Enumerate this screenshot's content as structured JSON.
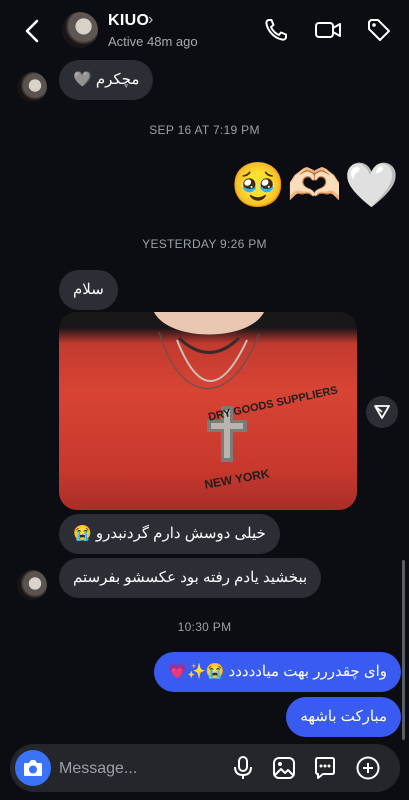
{
  "header": {
    "name": "KIUO",
    "status": "Active 48m ago"
  },
  "messages": {
    "m1": "مچکرم 🩶",
    "ts1": "SEP 16 AT 7:19 PM",
    "emoji_row": "🥹🫶🏻🤍",
    "ts2": "YESTERDAY 9:26 PM",
    "m2": "سلام",
    "m3": "خیلی دوسش دارم گردنبدرو 😭",
    "m4": "ببخشید یادم رفته بود عکسشو بفرستم",
    "ts3": "10:30 PM",
    "m5": "وای چقدررر بهت میاددددد 😭✨💗",
    "m6": "مبارکت باشهه"
  },
  "photo": {
    "shirt_lines": [
      "DRY GOODS SUPPLIERS",
      "NEW YORK"
    ]
  },
  "composer": {
    "placeholder": "Message..."
  },
  "colors": {
    "background": "#0b0d12",
    "incoming_bubble": "#2b2e35",
    "outgoing_bubble": "#3a5bf1",
    "camera_button": "#3a73f7"
  },
  "icons": [
    "back-arrow-icon",
    "chevron-right-icon",
    "phone-icon",
    "video-icon",
    "tag-icon",
    "send-icon",
    "camera-icon",
    "microphone-icon",
    "gallery-icon",
    "sticker-icon",
    "plus-icon"
  ]
}
